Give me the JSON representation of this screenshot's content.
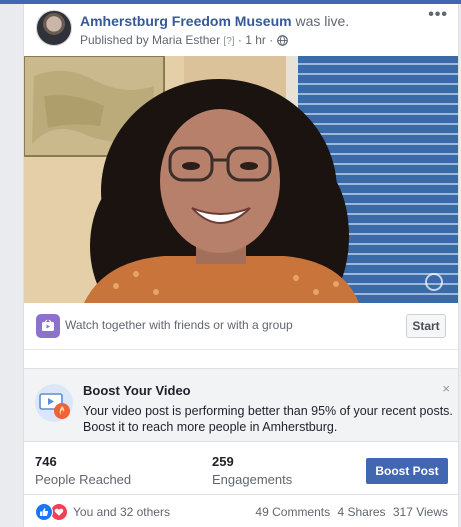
{
  "post": {
    "page_name": "Amherstburg Freedom Museum",
    "status_text": "was live.",
    "published_by": "Published by Maria Esther",
    "info_mark": "[?]",
    "time": "1 hr",
    "separator": "·",
    "more_label": "•••"
  },
  "watch_together": {
    "text": "Watch together with friends or with a group",
    "start_label": "Start"
  },
  "boost": {
    "title": "Boost Your Video",
    "description": "Your video post is performing better than 95% of your recent posts. Boost it to reach more people in Amherstburg.",
    "close_label": "×"
  },
  "stats": {
    "reached_value": "746",
    "reached_label": "People Reached",
    "engagements_value": "259",
    "engagements_label": "Engagements",
    "boost_button_label": "Boost Post"
  },
  "reactions": {
    "icons": [
      "like-icon",
      "love-icon"
    ],
    "text": "You and 32 others",
    "comments": "49 Comments",
    "shares": "4 Shares",
    "views": "317 Views"
  },
  "colors": {
    "brand": "#4267b2",
    "link": "#385898",
    "watch_icon_bg": "#8c72cb",
    "like": "#1877f2",
    "love": "#f33e58"
  }
}
